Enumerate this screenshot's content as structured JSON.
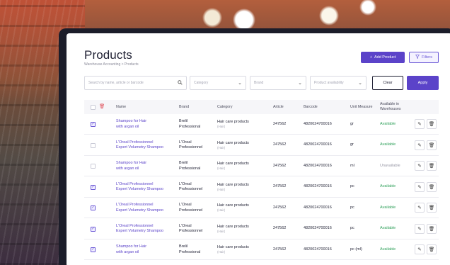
{
  "page": {
    "title": "Products",
    "breadcrumb": "Warehouse Accounting  >  Products",
    "add_button": "Add Product",
    "filters_button": "Filters"
  },
  "filters": {
    "search_placeholder": "Search by name, article or barcode",
    "category": "Category",
    "brand": "Brand",
    "availability": "Product availability",
    "clear": "Clear",
    "apply": "Apply"
  },
  "table": {
    "headers": {
      "name": "Name",
      "brand": "Brand",
      "category": "Category",
      "article": "Article",
      "barcode": "Barcode",
      "unit": "Unit Measure",
      "available": "Available in Warehouses"
    },
    "rows": [
      {
        "checked": true,
        "name1": "Shampoo for Hair",
        "name2": "with argan oil",
        "brand1": "Brelil",
        "brand2": "Professional",
        "cat": "Hair care products",
        "cat_sub": "(Hair)",
        "article": "247562",
        "barcode": "4820024700016",
        "unit": "gr",
        "status": "Available"
      },
      {
        "checked": false,
        "name1": "L'Oreal Professionnel",
        "name2": "Expert Volumetry Shampoo",
        "brand1": "L'Oreal",
        "brand2": "Professionnel",
        "cat": "Hair care products",
        "cat_sub": "(Hair)",
        "article": "247562",
        "barcode": "4820024700016",
        "unit": "gr",
        "status": "Available"
      },
      {
        "checked": false,
        "name1": "Shampoo for Hair",
        "name2": "with argan oil",
        "brand1": "Brelil",
        "brand2": "Professional",
        "cat": "Hair care products",
        "cat_sub": "(Hair)",
        "article": "247562",
        "barcode": "4820024700016",
        "unit": "ml",
        "status": "Unavailable"
      },
      {
        "checked": true,
        "name1": "L'Oreal Professionnel",
        "name2": "Expert Volumetry Shampoo",
        "brand1": "L'Oreal",
        "brand2": "Professionnel",
        "cat": "Hair care products",
        "cat_sub": "(Hair)",
        "article": "247562",
        "barcode": "4820024700016",
        "unit": "pc",
        "status": "Available"
      },
      {
        "checked": true,
        "name1": "L'Oreal Professionnel",
        "name2": "Expert Volumetry Shampoo",
        "brand1": "L'Oreal",
        "brand2": "Professionnel",
        "cat": "Hair care products",
        "cat_sub": "(Hair)",
        "article": "247562",
        "barcode": "4820024700016",
        "unit": "pc",
        "status": "Available"
      },
      {
        "checked": true,
        "name1": "L'Oreal Professionnel",
        "name2": "Expert Volumetry Shampoo",
        "brand1": "L'Oreal",
        "brand2": "Professionnel",
        "cat": "Hair care products",
        "cat_sub": "(Hair)",
        "article": "247562",
        "barcode": "4820024700016",
        "unit": "pc",
        "status": "Available"
      },
      {
        "checked": true,
        "name1": "Shampoo for Hair",
        "name2": "with argan oil",
        "brand1": "Brelil",
        "brand2": "Professional",
        "cat": "Hair care products",
        "cat_sub": "(Hair)",
        "article": "247562",
        "barcode": "4820024700016",
        "unit": "pc (ml)",
        "status": "Available"
      }
    ]
  },
  "colors": {
    "accent": "#5b43c9",
    "available": "#2fa05a",
    "unavailable": "#9a9aa8"
  }
}
